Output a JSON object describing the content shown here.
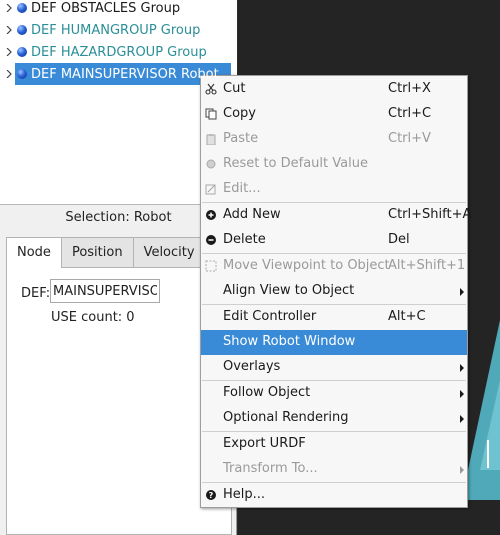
{
  "scene_tree": {
    "items": [
      {
        "label": "DEF OBSTACLES Group",
        "style": "black"
      },
      {
        "label": "DEF HUMANGROUP Group",
        "style": "teal"
      },
      {
        "label": "DEF HAZARDGROUP Group",
        "style": "teal"
      },
      {
        "label": "DEF MAINSUPERVISOR Robot",
        "style": "selected"
      }
    ]
  },
  "field_editor": {
    "selection_title": "Selection: Robot",
    "tabs": [
      "Node",
      "Position",
      "Velocity"
    ],
    "active_tab": "Node",
    "def_label": "DEF:",
    "def_value": "MAINSUPERVISOR",
    "use_count": "USE count: 0"
  },
  "context_menu": {
    "items": [
      {
        "icon": "scissors-icon",
        "label": "Cut",
        "shortcut": "Ctrl+X",
        "enabled": true
      },
      {
        "icon": "copy-icon",
        "label": "Copy",
        "shortcut": "Ctrl+C",
        "enabled": true
      },
      {
        "icon": "paste-icon",
        "label": "Paste",
        "shortcut": "Ctrl+V",
        "enabled": false
      },
      {
        "icon": "reset-icon",
        "label": "Reset to Default Value",
        "shortcut": "",
        "enabled": false
      },
      {
        "icon": "edit-icon",
        "label": "Edit...",
        "shortcut": "",
        "enabled": false
      },
      {
        "icon": "add-icon",
        "label": "Add New",
        "shortcut": "Ctrl+Shift+A",
        "enabled": true
      },
      {
        "icon": "delete-icon",
        "label": "Delete",
        "shortcut": "Del",
        "enabled": true
      },
      {
        "icon": "move-viewpoint-icon",
        "label": "Move Viewpoint to Object",
        "shortcut": "Alt+Shift+1",
        "enabled": false
      },
      {
        "icon": "",
        "label": "Align View to Object",
        "shortcut": "",
        "enabled": true,
        "submenu": true
      },
      {
        "icon": "",
        "label": "Edit Controller",
        "shortcut": "Alt+C",
        "enabled": true
      },
      {
        "icon": "",
        "label": "Show Robot Window",
        "shortcut": "",
        "enabled": true,
        "highlighted": true
      },
      {
        "icon": "",
        "label": "Overlays",
        "shortcut": "",
        "enabled": true,
        "submenu": true
      },
      {
        "icon": "",
        "label": "Follow Object",
        "shortcut": "",
        "enabled": true,
        "submenu": true
      },
      {
        "icon": "",
        "label": "Optional Rendering",
        "shortcut": "",
        "enabled": true,
        "submenu": true
      },
      {
        "icon": "",
        "label": "Export URDF",
        "shortcut": "",
        "enabled": true
      },
      {
        "icon": "",
        "label": "Transform To...",
        "shortcut": "",
        "enabled": false,
        "submenu": true
      },
      {
        "icon": "help-icon",
        "label": "Help...",
        "shortcut": "",
        "enabled": true
      }
    ]
  },
  "colors": {
    "selection_blue": "#3a8bd7",
    "teal_text": "#2a8f96",
    "viewport_dark": "#242424",
    "viewport_cyan": "#4fa9b8"
  }
}
